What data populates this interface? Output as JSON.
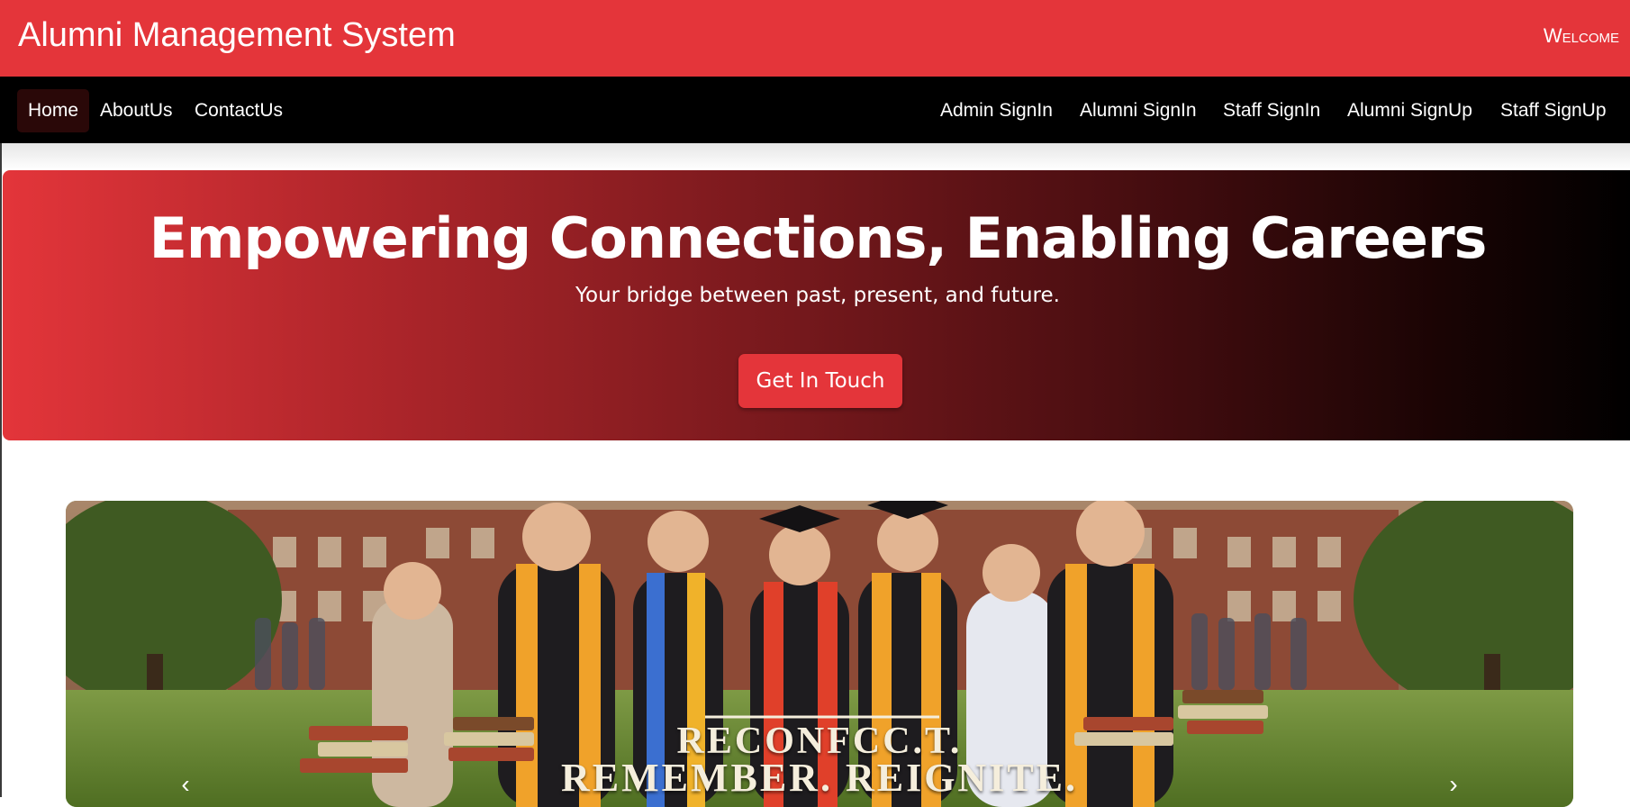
{
  "header": {
    "title": "Alumni Management System",
    "welcome": "Welcome"
  },
  "nav": {
    "left": [
      {
        "label": "Home",
        "active": true
      },
      {
        "label": "AboutUs"
      },
      {
        "label": "ContactUs"
      }
    ],
    "right": [
      {
        "label": "Admin SignIn"
      },
      {
        "label": "Alumni SignIn"
      },
      {
        "label": "Staff SignIn"
      },
      {
        "label": "Alumni SignUp"
      },
      {
        "label": "Staff SignUp"
      }
    ]
  },
  "hero": {
    "headline": "Empowering Connections, Enabling Careers",
    "subline": "Your bridge between past, present, and future.",
    "cta": "Get In Touch"
  },
  "banner": {
    "caption_line1": "RECONFCC.T.",
    "caption_line2": "REMEMBER. REIGNITE.",
    "prev_icon": "chevron-left-icon",
    "next_icon": "chevron-right-icon"
  },
  "colors": {
    "brand_red": "#e4353a",
    "nav_bg": "#000000",
    "active_nav_bg": "#2a0808"
  }
}
